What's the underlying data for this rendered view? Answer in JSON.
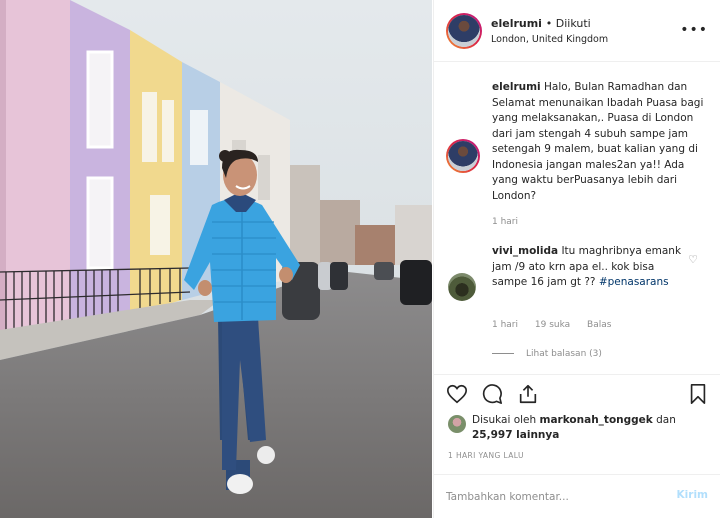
{
  "post": {
    "username": "elelrumi",
    "follow_status": "• Diikuti",
    "location": "London, United Kingdom",
    "more_menu": "•••"
  },
  "caption": {
    "username": "elelrumi",
    "text": "Halo, Bulan Ramadhan dan Selamat menunaikan Ibadah Puasa bagi yang melaksanakan,. Puasa di London dari jam stengah 4 subuh sampe jam setengah 9 malem, buat kalian yang di Indonesia jangan males2an ya!! Ada yang waktu berPuasanya lebih dari London?",
    "time": "1 hari"
  },
  "comments": [
    {
      "username": "vivi_molida",
      "text": "Itu maghribnya emank jam /9 ato krn apa el.. kok bisa sampe 16 jam gt ??",
      "hashtag": "#penasarans",
      "time": "1 hari",
      "likes": "19 suka",
      "reply_label": "Balas",
      "view_replies": "Lihat balasan (3)"
    }
  ],
  "likes": {
    "prefix": "Disukai oleh",
    "liker": "markonah_tonggek",
    "middle": "dan",
    "others_count": "25,997 lainnya"
  },
  "posted_ago": "1 HARI YANG LALU",
  "comment_box": {
    "placeholder": "Tambahkan komentar...",
    "post_label": "Kirim"
  },
  "icons": {
    "like": "heart-icon",
    "comment": "comment-icon",
    "share": "share-icon",
    "save": "bookmark-icon"
  },
  "colors": {
    "text": "#262626",
    "muted": "#8e8e8e",
    "link": "#003569",
    "post_disabled": "#b2dffc"
  }
}
